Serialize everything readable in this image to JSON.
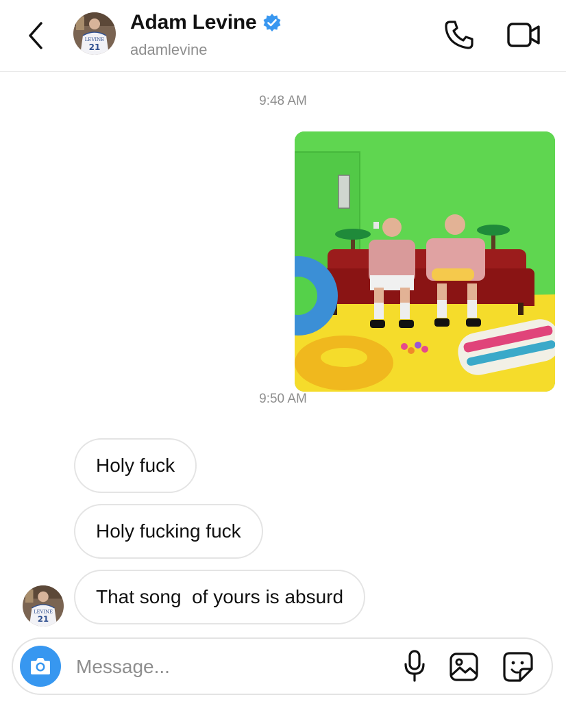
{
  "header": {
    "contact_name": "Adam Levine",
    "username": "adamlevine",
    "verified": true,
    "icons": {
      "back": "chevron-left-icon",
      "verified": "verified-badge-icon",
      "call": "phone-icon",
      "video": "video-camera-icon"
    }
  },
  "avatar": {
    "jersey_text": "LEVINE",
    "jersey_number": "21"
  },
  "thread": {
    "timestamps": [
      "9:48 AM",
      "9:50 AM"
    ],
    "sent_photo": {
      "description_icon": "photo-message"
    },
    "received_messages": [
      "Holy fuck",
      "Holy fucking fuck",
      "That song  of yours is absurd"
    ]
  },
  "composer": {
    "placeholder": "Message...",
    "value": "",
    "icons": {
      "camera": "camera-icon",
      "mic": "microphone-icon",
      "gallery": "image-icon",
      "sticker": "sticker-icon"
    }
  },
  "colors": {
    "accent": "#3797f0",
    "verified": "#3897f0",
    "secondary_text": "#8e8e8e",
    "bubble_border": "#e4e4e4"
  }
}
